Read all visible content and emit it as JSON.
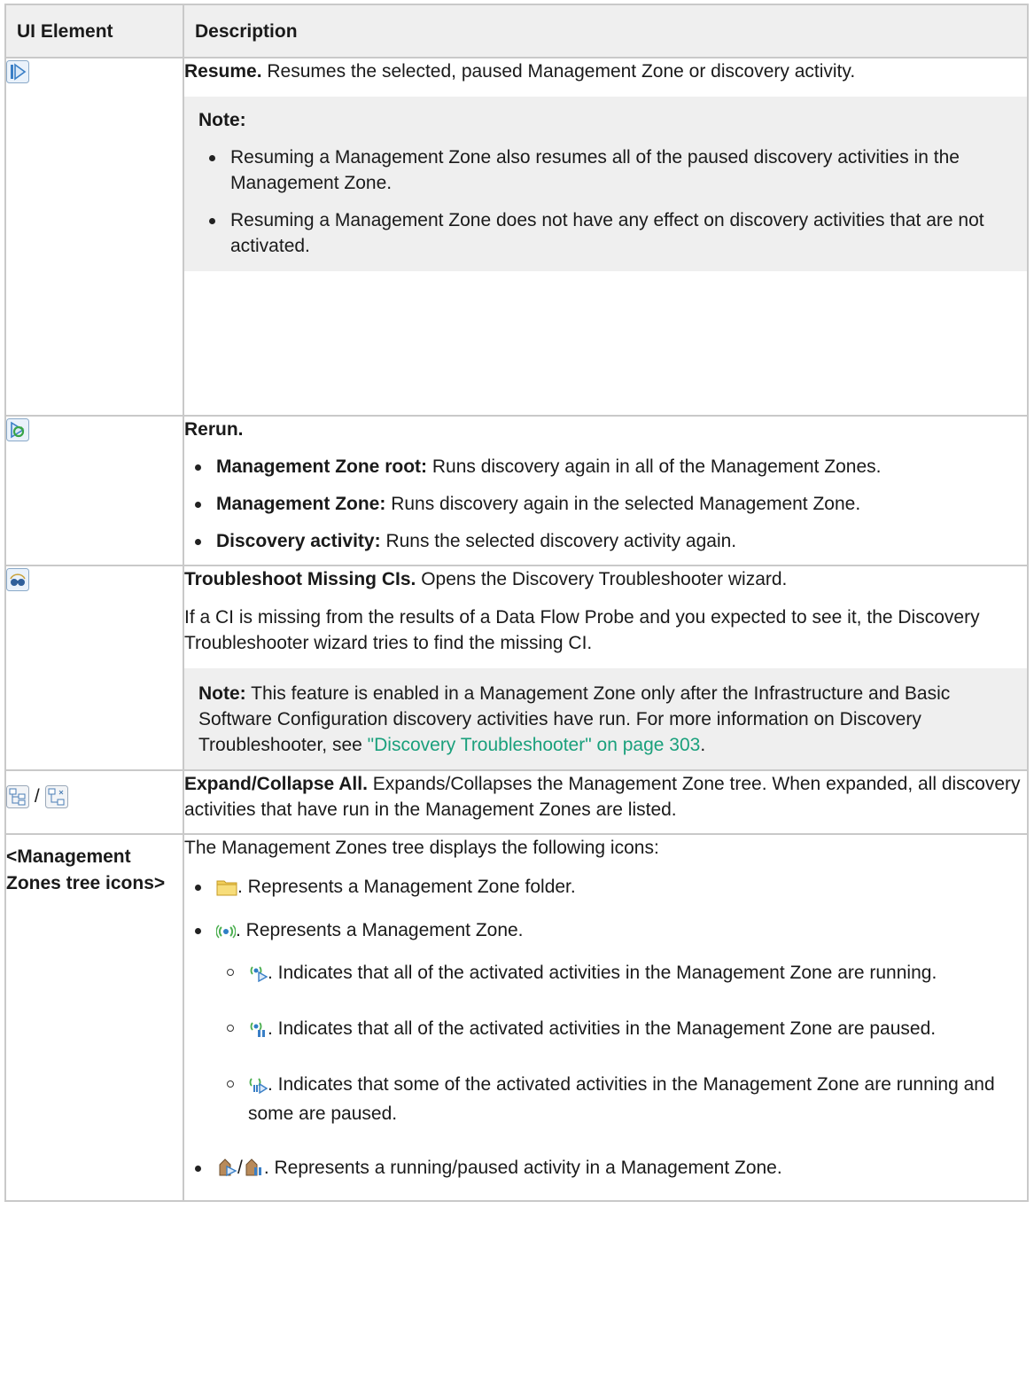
{
  "header": {
    "col1": "UI Element",
    "col2": "Description"
  },
  "rows": {
    "resume": {
      "title": "Resume.",
      "text": " Resumes the selected, paused Management Zone or discovery activity.",
      "note_label": "Note:",
      "note_items": [
        "Resuming a Management Zone also resumes all of the paused discovery activities in the Management Zone.",
        "Resuming a Management Zone does not have any effect on discovery activities that are not activated."
      ]
    },
    "rerun": {
      "title": "Rerun.",
      "items": [
        {
          "term": "Management Zone root:",
          "text": " Runs discovery again in all of the Management Zones."
        },
        {
          "term": "Management Zone:",
          "text": " Runs discovery again in the selected Management Zone."
        },
        {
          "term": "Discovery activity:",
          "text": " Runs the selected discovery activity again."
        }
      ]
    },
    "troubleshoot": {
      "title": "Troubleshoot Missing CIs.",
      "text": " Opens the Discovery Troubleshooter wizard.",
      "para": "If a CI is missing from the results of a Data Flow Probe and you expected to see it, the Discovery Troubleshooter wizard tries to find the missing CI.",
      "note_label": "Note:",
      "note_text": " This feature is enabled in a Management Zone only after the Infrastructure and Basic Software Configuration discovery activities have run. For more information on Discovery Troubleshooter, see ",
      "note_link": "\"Discovery Troubleshooter\" on page 303",
      "note_end": "."
    },
    "expand": {
      "separator": " / ",
      "title": "Expand/Collapse All.",
      "text": " Expands/Collapses the Management Zone tree. When expanded, all discovery activities that have run in the Management Zones are listed."
    },
    "tree": {
      "label": "<Management Zones tree icons>",
      "intro": "The Management Zones tree displays the following icons:",
      "folder_text": ". Represents a Management Zone folder.",
      "zone_text": ". Represents a Management Zone.",
      "sub": [
        ". Indicates that all of the activated activities in the Management Zone are running.",
        ". Indicates that all of the activated activities in the Management Zone are paused.",
        ". Indicates that some of the activated activities in the Management Zone are running and some are paused."
      ],
      "activity_sep": "/",
      "activity_text": ". Represents a running/paused activity in a Management Zone."
    }
  },
  "colors": {
    "header_bg": "#efefef",
    "border": "#c9c9c9",
    "link": "#1aa07c",
    "note_bg": "#efefef"
  }
}
